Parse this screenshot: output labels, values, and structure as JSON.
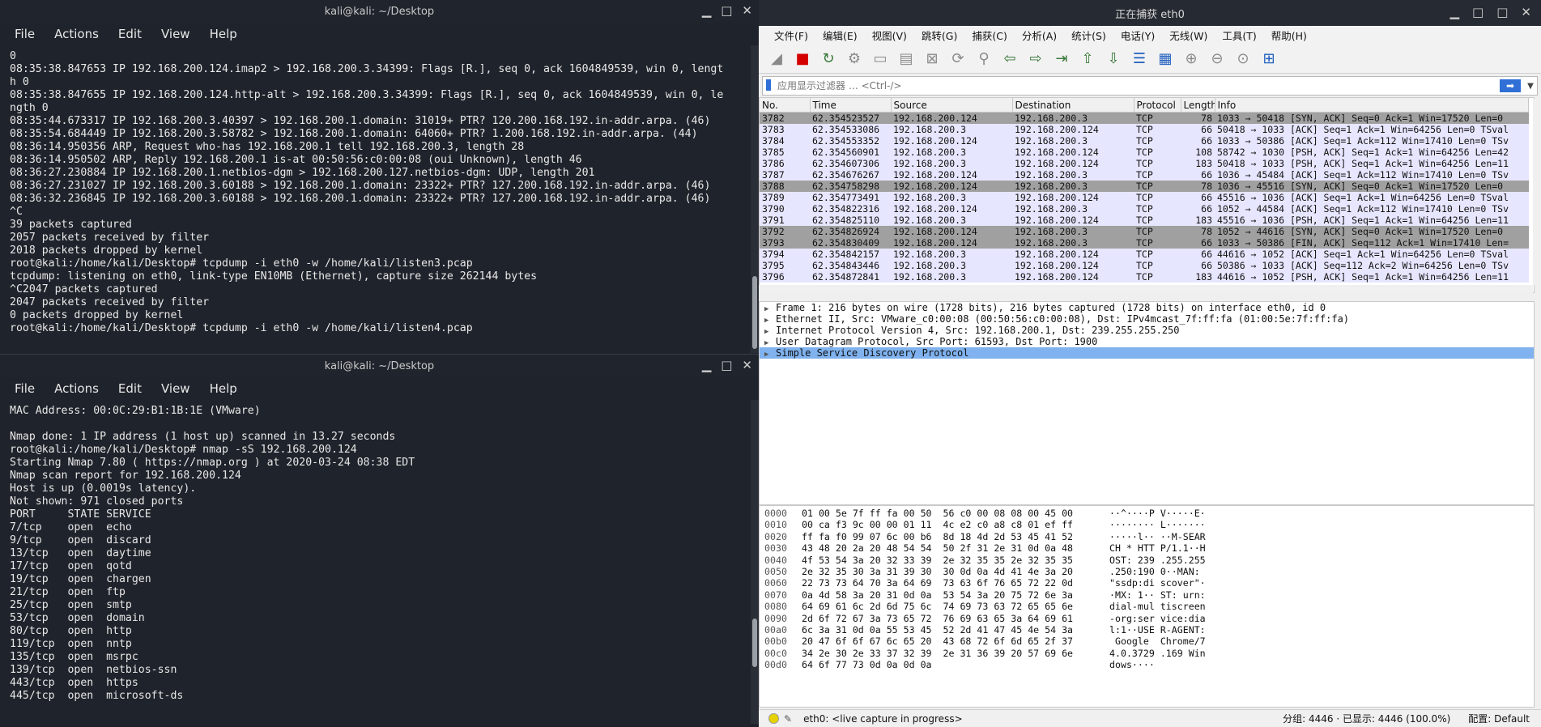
{
  "term1": {
    "title": "kali@kali: ~/Desktop",
    "menu": [
      "File",
      "Actions",
      "Edit",
      "View",
      "Help"
    ],
    "lines": [
      "0",
      "08:35:38.847653 IP 192.168.200.124.imap2 > 192.168.200.3.34399: Flags [R.], seq 0, ack 1604849539, win 0, lengt",
      "h 0",
      "08:35:38.847655 IP 192.168.200.124.http-alt > 192.168.200.3.34399: Flags [R.], seq 0, ack 1604849539, win 0, le",
      "ngth 0",
      "08:35:44.673317 IP 192.168.200.3.40397 > 192.168.200.1.domain: 31019+ PTR? 120.200.168.192.in-addr.arpa. (46)",
      "08:35:54.684449 IP 192.168.200.3.58782 > 192.168.200.1.domain: 64060+ PTR? 1.200.168.192.in-addr.arpa. (44)",
      "08:36:14.950356 ARP, Request who-has 192.168.200.1 tell 192.168.200.3, length 28",
      "08:36:14.950502 ARP, Reply 192.168.200.1 is-at 00:50:56:c0:00:08 (oui Unknown), length 46",
      "08:36:27.230884 IP 192.168.200.1.netbios-dgm > 192.168.200.127.netbios-dgm: UDP, length 201",
      "08:36:27.231027 IP 192.168.200.3.60188 > 192.168.200.1.domain: 23322+ PTR? 127.200.168.192.in-addr.arpa. (46)",
      "08:36:32.236845 IP 192.168.200.3.60188 > 192.168.200.1.domain: 23322+ PTR? 127.200.168.192.in-addr.arpa. (46)",
      "^C",
      "39 packets captured",
      "2057 packets received by filter",
      "2018 packets dropped by kernel",
      "root@kali:/home/kali/Desktop# tcpdump -i eth0 -w /home/kali/listen3.pcap",
      "tcpdump: listening on eth0, link-type EN10MB (Ethernet), capture size 262144 bytes",
      "^C2047 packets captured",
      "2047 packets received by filter",
      "0 packets dropped by kernel",
      "root@kali:/home/kali/Desktop# tcpdump -i eth0 -w /home/kali/listen4.pcap"
    ]
  },
  "term2": {
    "title": "kali@kali: ~/Desktop",
    "menu": [
      "File",
      "Actions",
      "Edit",
      "View",
      "Help"
    ],
    "lines": [
      "MAC Address: 00:0C:29:B1:1B:1E (VMware)",
      "",
      "Nmap done: 1 IP address (1 host up) scanned in 13.27 seconds",
      "root@kali:/home/kali/Desktop# nmap -sS 192.168.200.124",
      "Starting Nmap 7.80 ( https://nmap.org ) at 2020-03-24 08:38 EDT",
      "Nmap scan report for 192.168.200.124",
      "Host is up (0.0019s latency).",
      "Not shown: 971 closed ports",
      "PORT     STATE SERVICE",
      "7/tcp    open  echo",
      "9/tcp    open  discard",
      "13/tcp   open  daytime",
      "17/tcp   open  qotd",
      "19/tcp   open  chargen",
      "21/tcp   open  ftp",
      "25/tcp   open  smtp",
      "53/tcp   open  domain",
      "80/tcp   open  http",
      "119/tcp  open  nntp",
      "135/tcp  open  msrpc",
      "139/tcp  open  netbios-ssn",
      "443/tcp  open  https",
      "445/tcp  open  microsoft-ds"
    ]
  },
  "wireshark": {
    "title": "正在捕获 eth0",
    "menu": [
      "文件(F)",
      "编辑(E)",
      "视图(V)",
      "跳转(G)",
      "捕获(C)",
      "分析(A)",
      "统计(S)",
      "电话(Y)",
      "无线(W)",
      "工具(T)",
      "帮助(H)"
    ],
    "filter_placeholder": "应用显示过滤器 … <Ctrl-/>",
    "columns": [
      "No.",
      "Time",
      "Source",
      "Destination",
      "Protocol",
      "Length",
      "Info"
    ],
    "packets": [
      {
        "no": "3782",
        "time": "62.354523527",
        "src": "192.168.200.124",
        "dst": "192.168.200.3",
        "proto": "TCP",
        "len": "78",
        "info": "1033 → 50418 [SYN, ACK] Seq=0 Ack=1 Win=17520 Len=0",
        "style": "g"
      },
      {
        "no": "3783",
        "time": "62.354533086",
        "src": "192.168.200.3",
        "dst": "192.168.200.124",
        "proto": "TCP",
        "len": "66",
        "info": "50418 → 1033 [ACK] Seq=1 Ack=1 Win=64256 Len=0 TSval",
        "style": "n"
      },
      {
        "no": "3784",
        "time": "62.354553352",
        "src": "192.168.200.124",
        "dst": "192.168.200.3",
        "proto": "TCP",
        "len": "66",
        "info": "1033 → 50386 [ACK] Seq=1 Ack=112 Win=17410 Len=0 TSv",
        "style": "n"
      },
      {
        "no": "3785",
        "time": "62.354560901",
        "src": "192.168.200.3",
        "dst": "192.168.200.124",
        "proto": "TCP",
        "len": "108",
        "info": "58742 → 1030 [PSH, ACK] Seq=1 Ack=1 Win=64256 Len=42",
        "style": "n"
      },
      {
        "no": "3786",
        "time": "62.354607306",
        "src": "192.168.200.3",
        "dst": "192.168.200.124",
        "proto": "TCP",
        "len": "183",
        "info": "50418 → 1033 [PSH, ACK] Seq=1 Ack=1 Win=64256 Len=11",
        "style": "n"
      },
      {
        "no": "3787",
        "time": "62.354676267",
        "src": "192.168.200.124",
        "dst": "192.168.200.3",
        "proto": "TCP",
        "len": "66",
        "info": "1036 → 45484 [ACK] Seq=1 Ack=112 Win=17410 Len=0 TSv",
        "style": "n"
      },
      {
        "no": "3788",
        "time": "62.354758298",
        "src": "192.168.200.124",
        "dst": "192.168.200.3",
        "proto": "TCP",
        "len": "78",
        "info": "1036 → 45516 [SYN, ACK] Seq=0 Ack=1 Win=17520 Len=0",
        "style": "g"
      },
      {
        "no": "3789",
        "time": "62.354773491",
        "src": "192.168.200.3",
        "dst": "192.168.200.124",
        "proto": "TCP",
        "len": "66",
        "info": "45516 → 1036 [ACK] Seq=1 Ack=1 Win=64256 Len=0 TSval",
        "style": "n"
      },
      {
        "no": "3790",
        "time": "62.354822316",
        "src": "192.168.200.124",
        "dst": "192.168.200.3",
        "proto": "TCP",
        "len": "66",
        "info": "1052 → 44584 [ACK] Seq=1 Ack=112 Win=17410 Len=0 TSv",
        "style": "n"
      },
      {
        "no": "3791",
        "time": "62.354825110",
        "src": "192.168.200.3",
        "dst": "192.168.200.124",
        "proto": "TCP",
        "len": "183",
        "info": "45516 → 1036 [PSH, ACK] Seq=1 Ack=1 Win=64256 Len=11",
        "style": "n"
      },
      {
        "no": "3792",
        "time": "62.354826924",
        "src": "192.168.200.124",
        "dst": "192.168.200.3",
        "proto": "TCP",
        "len": "78",
        "info": "1052 → 44616 [SYN, ACK] Seq=0 Ack=1 Win=17520 Len=0",
        "style": "g"
      },
      {
        "no": "3793",
        "time": "62.354830409",
        "src": "192.168.200.124",
        "dst": "192.168.200.3",
        "proto": "TCP",
        "len": "66",
        "info": "1033 → 50386 [FIN, ACK] Seq=112 Ack=1 Win=17410 Len=",
        "style": "g"
      },
      {
        "no": "3794",
        "time": "62.354842157",
        "src": "192.168.200.3",
        "dst": "192.168.200.124",
        "proto": "TCP",
        "len": "66",
        "info": "44616 → 1052 [ACK] Seq=1 Ack=1 Win=64256 Len=0 TSval",
        "style": "n"
      },
      {
        "no": "3795",
        "time": "62.354843446",
        "src": "192.168.200.3",
        "dst": "192.168.200.124",
        "proto": "TCP",
        "len": "66",
        "info": "50386 → 1033 [ACK] Seq=112 Ack=2 Win=64256 Len=0 TSv",
        "style": "n"
      },
      {
        "no": "3796",
        "time": "62.354872841",
        "src": "192.168.200.3",
        "dst": "192.168.200.124",
        "proto": "TCP",
        "len": "183",
        "info": "44616 → 1052 [PSH, ACK] Seq=1 Ack=1 Win=64256 Len=11",
        "style": "n"
      }
    ],
    "details": [
      "Frame 1: 216 bytes on wire (1728 bits), 216 bytes captured (1728 bits) on interface eth0, id 0",
      "Ethernet II, Src: VMware_c0:00:08 (00:50:56:c0:00:08), Dst: IPv4mcast_7f:ff:fa (01:00:5e:7f:ff:fa)",
      "Internet Protocol Version 4, Src: 192.168.200.1, Dst: 239.255.255.250",
      "User Datagram Protocol, Src Port: 61593, Dst Port: 1900",
      "Simple Service Discovery Protocol"
    ],
    "hex": [
      {
        "off": "0000",
        "bytes": "01 00 5e 7f ff fa 00 50  56 c0 00 08 08 00 45 00",
        "ascii": "··^····P V·····E·"
      },
      {
        "off": "0010",
        "bytes": "00 ca f3 9c 00 00 01 11  4c e2 c0 a8 c8 01 ef ff",
        "ascii": "········ L·······"
      },
      {
        "off": "0020",
        "bytes": "ff fa f0 99 07 6c 00 b6  8d 18 4d 2d 53 45 41 52",
        "ascii": "·····l·· ··M-SEAR"
      },
      {
        "off": "0030",
        "bytes": "43 48 20 2a 20 48 54 54  50 2f 31 2e 31 0d 0a 48",
        "ascii": "CH * HTT P/1.1··H"
      },
      {
        "off": "0040",
        "bytes": "4f 53 54 3a 20 32 33 39  2e 32 35 35 2e 32 35 35",
        "ascii": "OST: 239 .255.255"
      },
      {
        "off": "0050",
        "bytes": "2e 32 35 30 3a 31 39 30  30 0d 0a 4d 41 4e 3a 20",
        "ascii": ".250:190 0··MAN: "
      },
      {
        "off": "0060",
        "bytes": "22 73 73 64 70 3a 64 69  73 63 6f 76 65 72 22 0d",
        "ascii": "\"ssdp:di scover\"·"
      },
      {
        "off": "0070",
        "bytes": "0a 4d 58 3a 20 31 0d 0a  53 54 3a 20 75 72 6e 3a",
        "ascii": "·MX: 1·· ST: urn:"
      },
      {
        "off": "0080",
        "bytes": "64 69 61 6c 2d 6d 75 6c  74 69 73 63 72 65 65 6e",
        "ascii": "dial-mul tiscreen"
      },
      {
        "off": "0090",
        "bytes": "2d 6f 72 67 3a 73 65 72  76 69 63 65 3a 64 69 61",
        "ascii": "-org:ser vice:dia"
      },
      {
        "off": "00a0",
        "bytes": "6c 3a 31 0d 0a 55 53 45  52 2d 41 47 45 4e 54 3a",
        "ascii": "l:1··USE R-AGENT:"
      },
      {
        "off": "00b0",
        "bytes": "20 47 6f 6f 67 6c 65 20  43 68 72 6f 6d 65 2f 37",
        "ascii": " Google  Chrome/7"
      },
      {
        "off": "00c0",
        "bytes": "34 2e 30 2e 33 37 32 39  2e 31 36 39 20 57 69 6e",
        "ascii": "4.0.3729 .169 Win"
      },
      {
        "off": "00d0",
        "bytes": "64 6f 77 73 0d 0a 0d 0a",
        "ascii": "dows····"
      }
    ],
    "status": {
      "capture": "eth0: <live capture in progress>",
      "packets": "分组: 4446 · 已显示: 4446 (100.0%)",
      "profile": "配置: Default"
    }
  }
}
